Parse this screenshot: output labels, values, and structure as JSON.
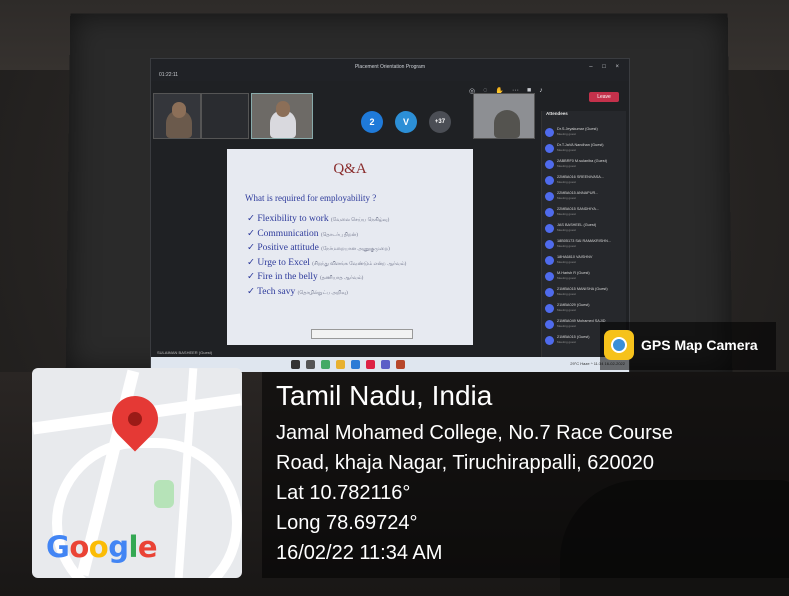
{
  "projection": {
    "meeting_title": "Placement Orientation Program",
    "timer": "01:22:11",
    "leave_label": "Leave",
    "tiles": [
      {
        "initial": "2",
        "color": "#1f7ad9"
      },
      {
        "initial": "V",
        "color": "#2c8fd6"
      },
      {
        "initial": "+37",
        "color": "#4b4e55"
      }
    ],
    "attendee_panel_title": "Attendees",
    "attendees": [
      {
        "name": "Dr.S.Jeyakumar (Guest)",
        "sub": "Meeting guest"
      },
      {
        "name": "Dr.T.JaVA Nandhan (Guest)",
        "sub": "Meeting guest"
      },
      {
        "name": "2ABBRF0 M.sulaniba (Guest)",
        "sub": "Meeting guest"
      },
      {
        "name": "22MBA016 SREENIVASA...",
        "sub": "Meeting guest"
      },
      {
        "name": "22MBA015 ANNAPUR...",
        "sub": "Meeting guest"
      },
      {
        "name": "22MBA015 SANDHIYA...",
        "sub": "Meeting guest"
      },
      {
        "name": "JAS BASHEEL (Guest)",
        "sub": "Meeting guest"
      },
      {
        "name": "18B05173 SAI RAMAKRISHN...",
        "sub": "Meeting guest"
      },
      {
        "name": "18HA6810 VAISHNV",
        "sub": "Meeting guest"
      },
      {
        "name": "M.Harish R (Guest)",
        "sub": "Meeting guest"
      },
      {
        "name": "21MBA015 MANISHA (Guest)",
        "sub": "Meeting guest"
      },
      {
        "name": "21MBA029 (Guest)",
        "sub": "Meeting guest"
      },
      {
        "name": "21MBA049 Mohamed SAJID",
        "sub": "Meeting guest"
      },
      {
        "name": "21MBA015 (Guest)",
        "sub": "Meeting guest"
      }
    ],
    "taskbar_right": "29°C Haze ^ 11:34 16-02-2022",
    "owner_label": "SULAIMAN BASHEER (Guest)"
  },
  "slide": {
    "title": "Q&A",
    "question": "What is required for employability ?",
    "items": [
      {
        "text": "✓ Flexibility to work",
        "tamil": "(வேலை செய்ய நெகிழ்வு)"
      },
      {
        "text": "✓ Communication",
        "tamil": "(தொடர்பு திறன்)"
      },
      {
        "text": "✓ Positive attitude",
        "tamil": "(நேர்மறையான அணுகுமுறை)"
      },
      {
        "text": "✓ Urge to Excel",
        "tamil": "(சிறந்து விளங்க வேண்டும் என்ற ஆர்வம்)"
      },
      {
        "text": "✓ Fire in the belly",
        "tamil": "(தணியாத ஆர்வம்)"
      },
      {
        "text": "✓ Tech savy",
        "tamil": "(தொழில்நுட்ப அறிவு)"
      }
    ]
  },
  "map": {
    "logo": "Google",
    "pin_color": "#e53935"
  },
  "gps_badge": {
    "label": "GPS Map Camera"
  },
  "location": {
    "title": "Tamil Nadu, India",
    "address_line1": "Jamal Mohamed College, No.7 Race Course",
    "address_line2": "Road, khaja Nagar, Tiruchirappalli, 620020",
    "lat": "Lat 10.782116°",
    "long": "Long 78.69724°",
    "datetime": "16/02/22 11:34 AM"
  }
}
